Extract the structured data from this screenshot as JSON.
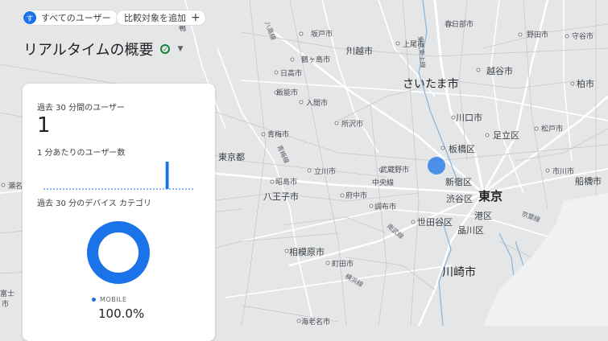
{
  "header": {
    "segment_badge": "す",
    "segment_label": "すべてのユーザー",
    "compare_label": "比較対象を追加",
    "compare_plus": "+",
    "title": "リアルタイムの概要"
  },
  "card": {
    "users_label": "過去 30 分間のユーザー",
    "users_value": "1",
    "per_minute_label": "1 分あたりのユーザー数",
    "device_label": "過去 30 分のデバイス カテゴリ",
    "legend_label": "MOBILE",
    "legend_value": "100.0%",
    "mobile_share": 1.0,
    "per_minute_counts": [
      0,
      0,
      0,
      0,
      0,
      0,
      0,
      0,
      0,
      0,
      0,
      0,
      0,
      0,
      0,
      0,
      0,
      0,
      0,
      0,
      0,
      0,
      0,
      0,
      1,
      0,
      0,
      0,
      0,
      0
    ]
  },
  "colors": {
    "accent": "#1a73e8",
    "check": "#188038",
    "map_bg": "#e5e6e8"
  },
  "map": {
    "labels": {
      "ageo": "上尾市",
      "kasukabe": "春日部市",
      "noda": "野田市",
      "moriya": "守谷市",
      "sakado": "坂戸市",
      "kawagoe": "川越市",
      "tsurugashima": "鶴ヶ島市",
      "hidaka": "日高市",
      "saitama": "さいたま市",
      "koshigaya": "越谷市",
      "kashiwa": "柏市",
      "hanno": "飯能市",
      "iruma": "入間市",
      "kawaguchi": "川口市",
      "tokorozawa": "所沢市",
      "adachi": "足立区",
      "matsudo": "松戸市",
      "ome": "青梅市",
      "itabashi": "板橋区",
      "tokyo_pref": "東京都",
      "tachikawa": "立川市",
      "musashino": "武蔵野市",
      "ichikawa": "市川市",
      "funabashi": "船橋市",
      "akishima": "昭島市",
      "chuo_line": "中央線",
      "shinjuku": "新宿区",
      "hachioji": "八王子市",
      "fuchu": "府中市",
      "shibuya": "渋谷区",
      "tokyo": "東京",
      "chofu": "調布市",
      "minato": "港区",
      "keiyo_line": "京葉線",
      "setagaya": "世田谷区",
      "shinagawa": "品川区",
      "nambu_line": "南武線",
      "sagamihara": "相模原市",
      "machida": "町田市",
      "kawasaki": "川崎市",
      "yokohama_line": "横浜線",
      "ebina": "海老名市",
      "hachiko_line": "八高線",
      "oume_line": "青梅線",
      "tobu_line": "東武東上線",
      "fuji": "富士",
      "fuji_city": "市",
      "higashi_line": "東北",
      "shin_line": "新幹線",
      "nanushi": "瀬名",
      "kamo": "鴨",
      "musashi_line": "武蔵野線",
      "kawaguchi2": "川口"
    }
  }
}
